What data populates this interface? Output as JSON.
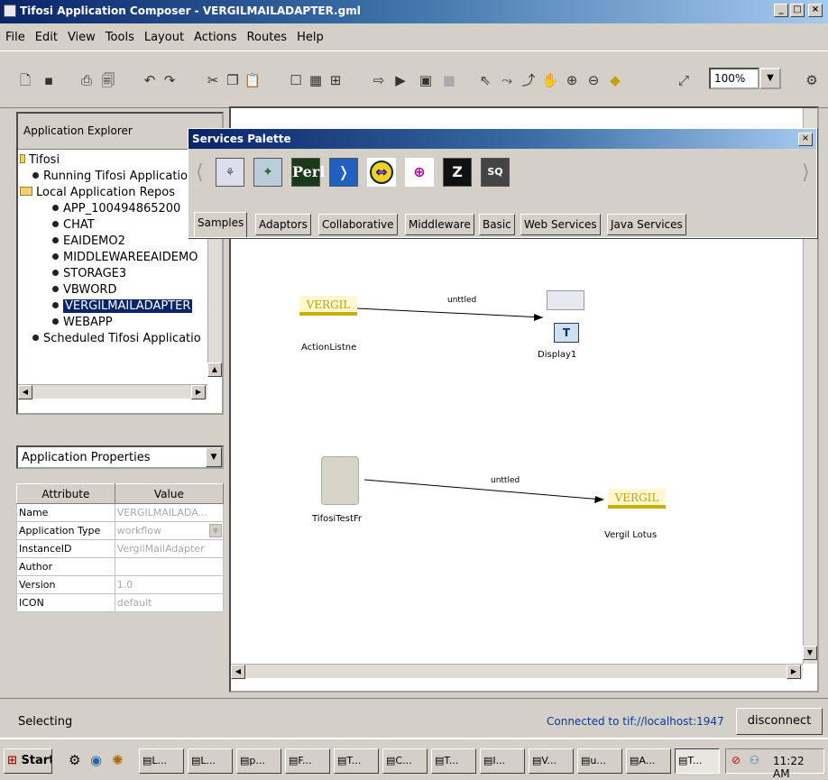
{
  "window": {
    "title": "Tifosi Application Composer - VERGILMAILADAPTER.gml"
  },
  "menu": [
    "File",
    "Edit",
    "View",
    "Tools",
    "Layout",
    "Actions",
    "Routes",
    "Help"
  ],
  "toolbar": {
    "zoom": "100%"
  },
  "explorer": {
    "title": "Application Explorer",
    "root": "Tifosi",
    "running": "Running Tifosi Applicatio",
    "local": "Local Application Repos",
    "apps": [
      "APP_100494865200",
      "CHAT",
      "EAIDEMO2",
      "MIDDLEWAREEAIDEMO",
      "STORAGE3",
      "VBWORD",
      "VERGILMAILADAPTER",
      "WEBAPP"
    ],
    "selected": "VERGILMAILADAPTER",
    "scheduled": "Scheduled Tifosi Applicatio"
  },
  "properties": {
    "selector": "Application Properties",
    "headers": {
      "attribute": "Attribute",
      "value": "Value"
    },
    "rows": [
      {
        "name": "Name",
        "value": "VERGILMAILADA..."
      },
      {
        "name": "Application Type",
        "value": "workflow"
      },
      {
        "name": "InstanceID",
        "value": "VergilMailAdapter"
      },
      {
        "name": "Author",
        "value": ""
      },
      {
        "name": "Version",
        "value": "1.0"
      },
      {
        "name": "ICON",
        "value": "default"
      }
    ]
  },
  "palette": {
    "title": "Services Palette",
    "icons": [
      "samples-icon",
      "adaptor-icon",
      "Perl",
      "jython-icon",
      "yellow-circle-icon",
      "crosshair-icon",
      "Z",
      "SQ"
    ],
    "tabs": [
      "Samples",
      "Adaptors",
      "Collaborative",
      "Middleware",
      "Basic",
      "Web Services",
      "Java Services"
    ],
    "active_tab": "Samples"
  },
  "canvas": {
    "nodes": {
      "action_listener": {
        "logo": "VERGIL",
        "label": "ActionListne"
      },
      "display": {
        "label": "Display1"
      },
      "tester": {
        "label": "TifosiTestFr"
      },
      "vergil_lotus": {
        "logo": "VERGIL",
        "label": "Vergil Lotus"
      }
    },
    "edges": [
      "unttled",
      "unttled"
    ]
  },
  "status": {
    "text": "Selecting",
    "connection": "Connected to tif://localhost:1947",
    "disconnect": "disconnect"
  },
  "taskbar": {
    "start": "Start",
    "tasks": [
      "L...",
      "L...",
      "p...",
      "F...",
      "T...",
      "C...",
      "T...",
      "I...",
      "V...",
      "u...",
      "A...",
      "T..."
    ],
    "clock": "11:22 AM"
  }
}
